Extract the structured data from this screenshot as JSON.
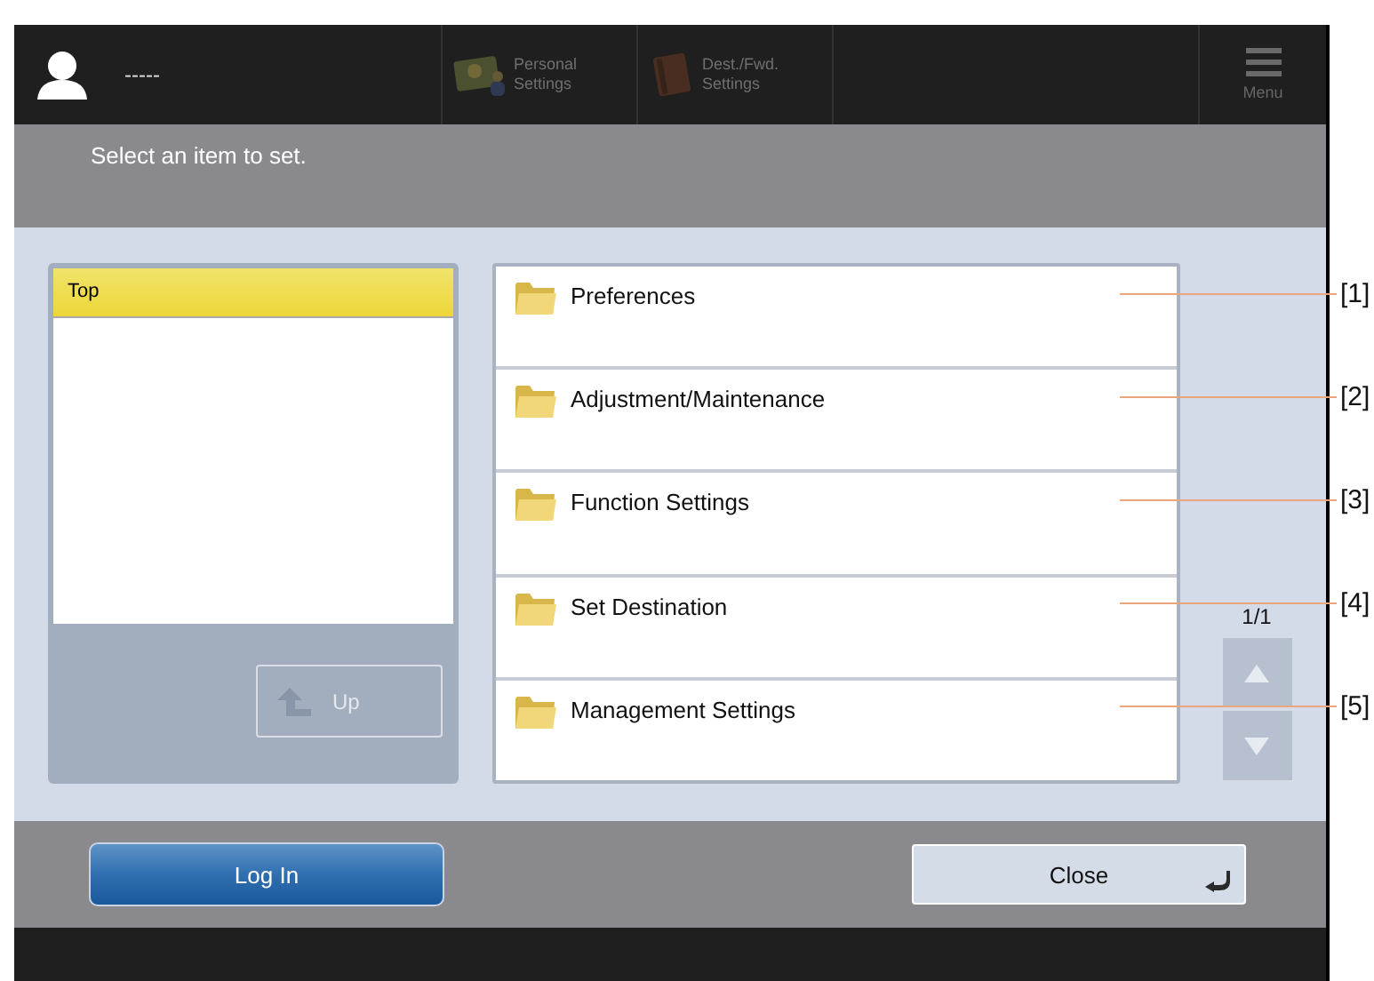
{
  "header": {
    "user_name": "-----",
    "shortcuts": [
      {
        "kind": "personal",
        "label_lines": [
          "Personal",
          "Settings"
        ],
        "disabled": true
      },
      {
        "kind": "book",
        "label_lines": [
          "Dest./Fwd.",
          "Settings"
        ],
        "disabled": true
      }
    ],
    "menu": {
      "label": "Menu",
      "disabled": true
    }
  },
  "message": "Select an item to set.",
  "tree": {
    "items": [
      {
        "label": "Top",
        "selected": true
      }
    ],
    "up_button": {
      "label": "Up",
      "disabled": true
    }
  },
  "items": [
    {
      "label": "Preferences",
      "callout": "[1]"
    },
    {
      "label": "Adjustment/Maintenance",
      "callout": "[2]"
    },
    {
      "label": "Function Settings",
      "callout": "[3]"
    },
    {
      "label": "Set Destination",
      "callout": "[4]"
    },
    {
      "label": "Management Settings",
      "callout": "[5]"
    }
  ],
  "pager": {
    "page": "1/1",
    "up_disabled": true,
    "down_disabled": true
  },
  "footer": {
    "login": "Log In",
    "close": "Close"
  }
}
